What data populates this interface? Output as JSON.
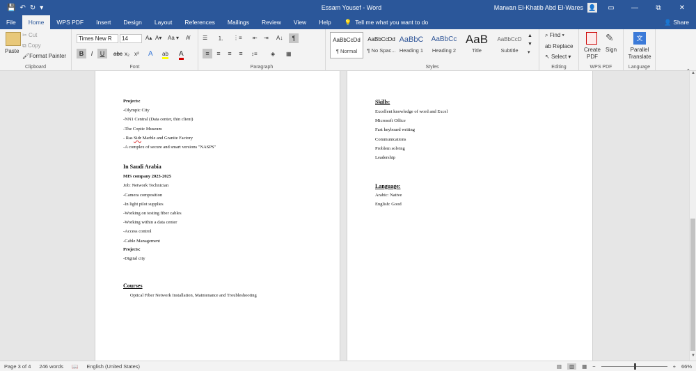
{
  "titlebar": {
    "doc_title": "Essam Yousef  -  Word",
    "user_name": "Marwan El-Khatib Abd El-Wares",
    "avatar_glyph": "👤",
    "minimize": "▭",
    "restore": "⧉",
    "close": "✕",
    "save_glyph": "💾",
    "undo_glyph": "↶",
    "redo_glyph": "↻",
    "qat_more": "▾"
  },
  "tabs": [
    {
      "label": "File"
    },
    {
      "label": "Home"
    },
    {
      "label": "WPS PDF"
    },
    {
      "label": "Insert"
    },
    {
      "label": "Design"
    },
    {
      "label": "Layout"
    },
    {
      "label": "References"
    },
    {
      "label": "Mailings"
    },
    {
      "label": "Review"
    },
    {
      "label": "View"
    },
    {
      "label": "Help"
    }
  ],
  "tell_me": {
    "glyph": "💡",
    "text": "Tell me what you want to do"
  },
  "share": {
    "glyph": "👤",
    "label": "Share"
  },
  "ribbon": {
    "clipboard": {
      "label": "Clipboard",
      "paste": "Paste",
      "cut": "Cut",
      "copy": "Copy",
      "format_painter": "Format Painter"
    },
    "font": {
      "label": "Font",
      "font_name": "Times New R",
      "font_size": "14",
      "grow": "A▴",
      "shrink": "A▾",
      "case": "Aa ▾",
      "clear": "A̸",
      "bold": "B",
      "italic": "I",
      "underline": "U",
      "strike": "abc",
      "subscript": "x₂",
      "superscript": "x²",
      "text_effects": "A",
      "highlight": "ab",
      "font_color": "A"
    },
    "paragraph": {
      "label": "Paragraph",
      "bullets": "☰",
      "numbering": "⒈",
      "multilevel": "⋮≡",
      "decrease_indent": "⇤",
      "increase_indent": "⇥",
      "sort": "A↓",
      "pilcrow": "¶",
      "align_left": "≡",
      "center": "≡",
      "align_right": "≡",
      "justify": "≡",
      "line_spacing": "↕≡",
      "shading": "◈",
      "borders": "▦"
    },
    "styles": {
      "label": "Styles",
      "items": [
        {
          "sample": "AaBbCcDd",
          "name": "¶ Normal"
        },
        {
          "sample": "AaBbCcDd",
          "name": "¶ No Spac..."
        },
        {
          "sample": "AaBbC",
          "name": "Heading 1"
        },
        {
          "sample": "AaBbCc",
          "name": "Heading 2"
        },
        {
          "sample": "AaB",
          "name": "Title"
        },
        {
          "sample": "AaBbCcD",
          "name": "Subtitle"
        }
      ]
    },
    "editing": {
      "label": "Editing",
      "find": "Find",
      "replace": "Replace",
      "select": "Select"
    },
    "wps_pdf": {
      "label": "WPS PDF",
      "create_pdf": "Create PDF",
      "sign": "Sign"
    },
    "language": {
      "label": "Language",
      "parallel_translate": "Parallel Translate"
    }
  },
  "page_left": {
    "lines": [
      {
        "text": "Projects:",
        "style": "b"
      },
      {
        "text": "-Olympic City",
        "style": ""
      },
      {
        "text": "-NN1 Central (Data center, thin client)",
        "style": ""
      },
      {
        "text": "-The Coptic Museum",
        "style": ""
      },
      {
        "text": "- Ras Sidr Marble and Granite Factory",
        "style": ""
      },
      {
        "text": "-A complex of secure and smart versions \"NASPS\"",
        "style": ""
      },
      {
        "text": "In Saudi Arabia",
        "style": "h"
      },
      {
        "text": "MIS company        2023-2025",
        "style": "b"
      },
      {
        "text": " Job: Network Technician",
        "style": ""
      },
      {
        "text": "-Camera composition",
        "style": ""
      },
      {
        "text": "-In light pilot supplies",
        "style": ""
      },
      {
        "text": "-Working on testing fiber cables",
        "style": ""
      },
      {
        "text": "-Working within a data center",
        "style": ""
      },
      {
        "text": "-Access control",
        "style": ""
      },
      {
        "text": "-Cable Management",
        "style": ""
      },
      {
        "text": "Projects:",
        "style": "b"
      },
      {
        "text": "-Digital city",
        "style": ""
      },
      {
        "text": "Courses",
        "style": "h u"
      },
      {
        "text": "Optical Fiber Network Installation, Maintenance and Troubleshooting",
        "style": ""
      }
    ]
  },
  "page_right": {
    "lines": [
      {
        "text": "Skills:",
        "style": "h u"
      },
      {
        "text": "Excellent knowledge of word and Excel",
        "style": ""
      },
      {
        "text": "Microsoft Office",
        "style": ""
      },
      {
        "text": "Fast keyboard writing",
        "style": ""
      },
      {
        "text": "Communications",
        "style": ""
      },
      {
        "text": "Problem solving",
        "style": ""
      },
      {
        "text": "Leadership",
        "style": ""
      },
      {
        "text": "Language:",
        "style": "h u"
      },
      {
        "text": "Arabic: Native",
        "style": ""
      },
      {
        "text": "English: Good",
        "style": ""
      }
    ]
  },
  "statusbar": {
    "page": "Page 3 of 4",
    "words": "246 words",
    "proof_glyph": "📖",
    "language": "English (United States)",
    "zoom_minus": "−",
    "zoom_plus": "+",
    "zoom_level": "66%",
    "zoom_fraction": 0.5
  },
  "colors": {
    "brand": "#2b579a",
    "highlight": "#ffff00",
    "font_color": "#d00000"
  }
}
